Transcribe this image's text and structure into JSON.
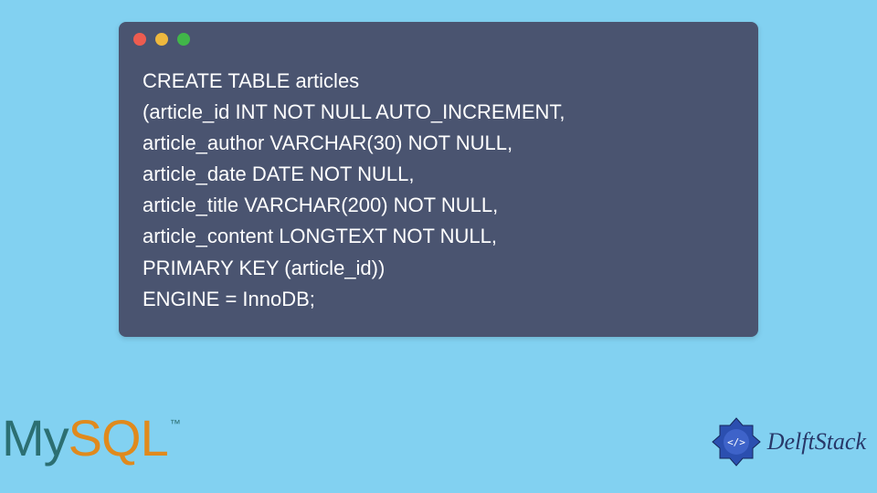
{
  "window": {
    "dots": [
      "red",
      "yellow",
      "green"
    ]
  },
  "code": {
    "text": "CREATE TABLE articles\n(article_id INT NOT NULL AUTO_INCREMENT,\narticle_author VARCHAR(30) NOT NULL,\narticle_date DATE NOT NULL,\narticle_title VARCHAR(200) NOT NULL,\narticle_content LONGTEXT NOT NULL,\nPRIMARY KEY (article_id))\nENGINE = InnoDB;"
  },
  "logos": {
    "mysql": {
      "part1": "My",
      "part2": "SQL",
      "tm": "™"
    },
    "delftstack": {
      "text": "DelftStack"
    }
  },
  "colors": {
    "page_bg": "#82d1f1",
    "window_bg": "#4a5470",
    "code_fg": "#ffffff",
    "mysql_my": "#2c6f72",
    "mysql_sql": "#e08a1d",
    "delft_primary": "#283869"
  }
}
